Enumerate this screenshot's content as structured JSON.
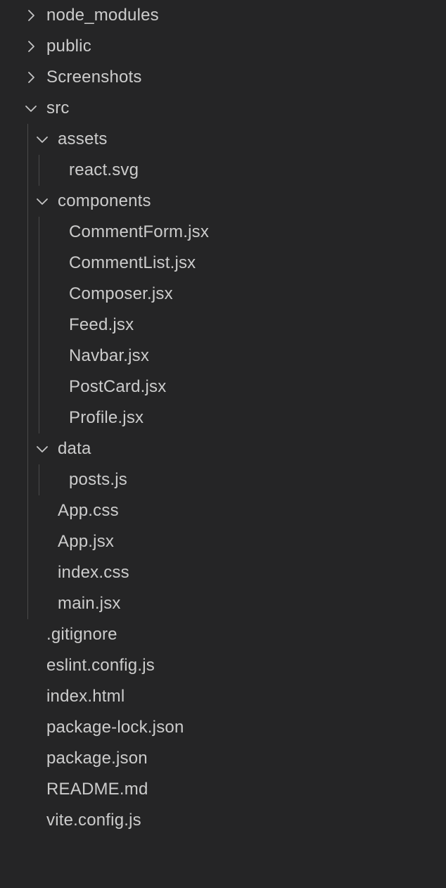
{
  "tree": [
    {
      "label": "node_modules",
      "depth": 0,
      "kind": "folder",
      "expanded": false
    },
    {
      "label": "public",
      "depth": 0,
      "kind": "folder",
      "expanded": false
    },
    {
      "label": "Screenshots",
      "depth": 0,
      "kind": "folder",
      "expanded": false
    },
    {
      "label": "src",
      "depth": 0,
      "kind": "folder",
      "expanded": true
    },
    {
      "label": "assets",
      "depth": 1,
      "kind": "folder",
      "expanded": true
    },
    {
      "label": "react.svg",
      "depth": 2,
      "kind": "file"
    },
    {
      "label": "components",
      "depth": 1,
      "kind": "folder",
      "expanded": true
    },
    {
      "label": "CommentForm.jsx",
      "depth": 2,
      "kind": "file"
    },
    {
      "label": "CommentList.jsx",
      "depth": 2,
      "kind": "file"
    },
    {
      "label": "Composer.jsx",
      "depth": 2,
      "kind": "file"
    },
    {
      "label": "Feed.jsx",
      "depth": 2,
      "kind": "file"
    },
    {
      "label": "Navbar.jsx",
      "depth": 2,
      "kind": "file"
    },
    {
      "label": "PostCard.jsx",
      "depth": 2,
      "kind": "file"
    },
    {
      "label": "Profile.jsx",
      "depth": 2,
      "kind": "file"
    },
    {
      "label": "data",
      "depth": 1,
      "kind": "folder",
      "expanded": true
    },
    {
      "label": "posts.js",
      "depth": 2,
      "kind": "file"
    },
    {
      "label": "App.css",
      "depth": 1,
      "kind": "file"
    },
    {
      "label": "App.jsx",
      "depth": 1,
      "kind": "file"
    },
    {
      "label": "index.css",
      "depth": 1,
      "kind": "file"
    },
    {
      "label": "main.jsx",
      "depth": 1,
      "kind": "file"
    },
    {
      "label": ".gitignore",
      "depth": 0,
      "kind": "file"
    },
    {
      "label": "eslint.config.js",
      "depth": 0,
      "kind": "file"
    },
    {
      "label": "index.html",
      "depth": 0,
      "kind": "file"
    },
    {
      "label": "package-lock.json",
      "depth": 0,
      "kind": "file"
    },
    {
      "label": "package.json",
      "depth": 0,
      "kind": "file"
    },
    {
      "label": "README.md",
      "depth": 0,
      "kind": "file"
    },
    {
      "label": "vite.config.js",
      "depth": 0,
      "kind": "file"
    }
  ],
  "colors": {
    "background": "#252526",
    "text": "#cccccc",
    "twistie": "#c5c5c5",
    "indent_guide": "#4a4a4a"
  },
  "icons": {
    "collapsed": "chevron-right-icon",
    "expanded": "chevron-down-icon"
  }
}
